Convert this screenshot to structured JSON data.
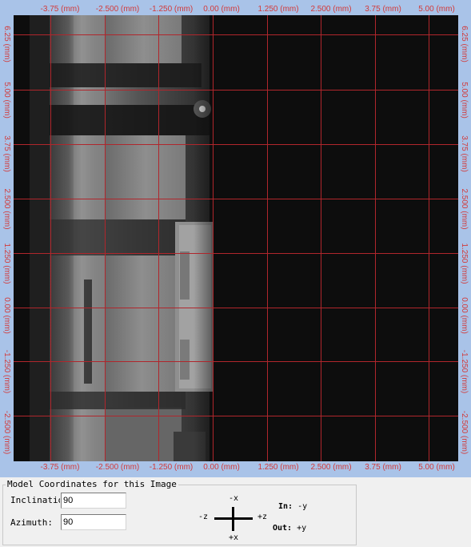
{
  "x_ticks": [
    "-3.75 (mm)",
    "-2.500 (mm)",
    "-1.250 (mm)",
    "0.00 (mm)",
    "1.250 (mm)",
    "2.500 (mm)",
    "3.75 (mm)",
    "5.00 (mm)"
  ],
  "y_ticks": [
    "6.25 (mm)",
    "5.00 (mm)",
    "3.75 (mm)",
    "2.500 (mm)",
    "1.250 (mm)",
    "0.00 (mm)",
    "-1.250 (mm)",
    "-2.500 (mm)"
  ],
  "colors": {
    "grid": "#b0262c",
    "tick_text": "#d23a3a",
    "image_bg": "#0d0d0d",
    "frame": "#a9c3e8"
  },
  "panel": {
    "title": "Model Coordinates for this Image",
    "inclination_label": "Inclination:",
    "inclination_value": "90",
    "azimuth_label": "Azimuth:",
    "azimuth_value": "90"
  },
  "axes": {
    "top": "-x",
    "bottom": "+x",
    "left": "-z",
    "right": "+z",
    "in_label": "In:",
    "in_value": "-y",
    "out_label": "Out:",
    "out_value": "+y"
  }
}
